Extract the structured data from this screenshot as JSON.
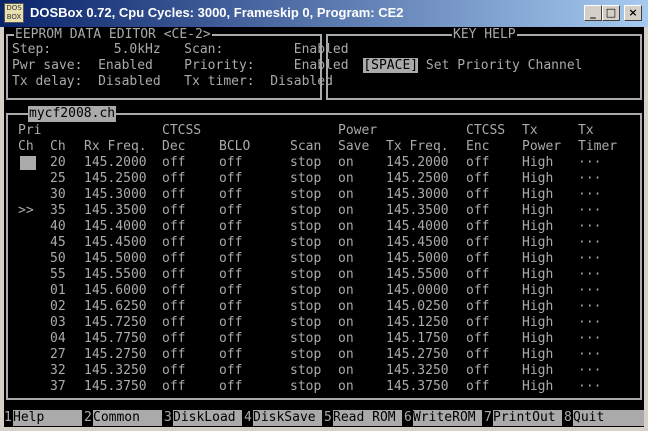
{
  "window": {
    "title": "DOSBox 0.72, Cpu Cycles:    3000, Frameskip  0, Program:     CE2",
    "icon_text": "DOS BOX",
    "minimize": "_",
    "maximize": "□",
    "close": "×"
  },
  "editor_box": {
    "title": "EEPROM DATA EDITOR <CE-2>",
    "lines": [
      "Step:        5.0kHz   Scan:         Enabled",
      "Pwr save:  Enabled    Priority:     Enabled",
      "Tx delay:  Disabled   Tx timer:  Disabled"
    ]
  },
  "key_help": {
    "title": "KEY HELP",
    "key": "[SPACE]",
    "text": " Set Priority Channel"
  },
  "channel_table": {
    "filename": "mycf2008.ch",
    "header_line1": [
      "Pri",
      "",
      "",
      "CTCSS",
      "",
      "",
      "Power",
      "",
      "CTCSS",
      "Tx",
      "Tx"
    ],
    "header_line2": [
      "Ch",
      "Ch",
      "Rx Freq.",
      "Dec",
      "BCLO",
      "Scan",
      "Save",
      "Tx Freq.",
      "Enc",
      "Power",
      "Timer"
    ],
    "rows": [
      {
        "pri": "",
        "ch": "20",
        "rx": "145.2000",
        "dec": "off",
        "bclo": "off",
        "scan": "stop",
        "save": "on",
        "tx": "145.2000",
        "enc": "off",
        "power": "High",
        "timer": "···"
      },
      {
        "pri": "",
        "ch": "25",
        "rx": "145.2500",
        "dec": "off",
        "bclo": "off",
        "scan": "stop",
        "save": "on",
        "tx": "145.2500",
        "enc": "off",
        "power": "High",
        "timer": "···"
      },
      {
        "pri": "",
        "ch": "30",
        "rx": "145.3000",
        "dec": "off",
        "bclo": "off",
        "scan": "stop",
        "save": "on",
        "tx": "145.3000",
        "enc": "off",
        "power": "High",
        "timer": "···"
      },
      {
        "pri": ">>",
        "ch": "35",
        "rx": "145.3500",
        "dec": "off",
        "bclo": "off",
        "scan": "stop",
        "save": "on",
        "tx": "145.3500",
        "enc": "off",
        "power": "High",
        "timer": "···"
      },
      {
        "pri": "",
        "ch": "40",
        "rx": "145.4000",
        "dec": "off",
        "bclo": "off",
        "scan": "stop",
        "save": "on",
        "tx": "145.4000",
        "enc": "off",
        "power": "High",
        "timer": "···"
      },
      {
        "pri": "",
        "ch": "45",
        "rx": "145.4500",
        "dec": "off",
        "bclo": "off",
        "scan": "stop",
        "save": "on",
        "tx": "145.4500",
        "enc": "off",
        "power": "High",
        "timer": "···"
      },
      {
        "pri": "",
        "ch": "50",
        "rx": "145.5000",
        "dec": "off",
        "bclo": "off",
        "scan": "stop",
        "save": "on",
        "tx": "145.5000",
        "enc": "off",
        "power": "High",
        "timer": "···"
      },
      {
        "pri": "",
        "ch": "55",
        "rx": "145.5500",
        "dec": "off",
        "bclo": "off",
        "scan": "stop",
        "save": "on",
        "tx": "145.5500",
        "enc": "off",
        "power": "High",
        "timer": "···"
      },
      {
        "pri": "",
        "ch": "01",
        "rx": "145.6000",
        "dec": "off",
        "bclo": "off",
        "scan": "stop",
        "save": "on",
        "tx": "145.0000",
        "enc": "off",
        "power": "High",
        "timer": "···"
      },
      {
        "pri": "",
        "ch": "02",
        "rx": "145.6250",
        "dec": "off",
        "bclo": "off",
        "scan": "stop",
        "save": "on",
        "tx": "145.0250",
        "enc": "off",
        "power": "High",
        "timer": "···"
      },
      {
        "pri": "",
        "ch": "03",
        "rx": "145.7250",
        "dec": "off",
        "bclo": "off",
        "scan": "stop",
        "save": "on",
        "tx": "145.1250",
        "enc": "off",
        "power": "High",
        "timer": "···"
      },
      {
        "pri": "",
        "ch": "04",
        "rx": "145.7750",
        "dec": "off",
        "bclo": "off",
        "scan": "stop",
        "save": "on",
        "tx": "145.1750",
        "enc": "off",
        "power": "High",
        "timer": "···"
      },
      {
        "pri": "",
        "ch": "27",
        "rx": "145.2750",
        "dec": "off",
        "bclo": "off",
        "scan": "stop",
        "save": "on",
        "tx": "145.2750",
        "enc": "off",
        "power": "High",
        "timer": "···"
      },
      {
        "pri": "",
        "ch": "32",
        "rx": "145.3250",
        "dec": "off",
        "bclo": "off",
        "scan": "stop",
        "save": "on",
        "tx": "145.3250",
        "enc": "off",
        "power": "High",
        "timer": "···"
      },
      {
        "pri": "",
        "ch": "37",
        "rx": "145.3750",
        "dec": "off",
        "bclo": "off",
        "scan": "stop",
        "save": "on",
        "tx": "145.3750",
        "enc": "off",
        "power": "High",
        "timer": "···"
      }
    ]
  },
  "function_keys": [
    {
      "num": "1",
      "label": "Help"
    },
    {
      "num": "2",
      "label": "Common"
    },
    {
      "num": "3",
      "label": "DiskLoad"
    },
    {
      "num": "4",
      "label": "DiskSave"
    },
    {
      "num": "5",
      "label": "Read ROM"
    },
    {
      "num": "6",
      "label": "WriteROM"
    },
    {
      "num": "7",
      "label": "PrintOut"
    },
    {
      "num": "8",
      "label": "Quit"
    }
  ]
}
